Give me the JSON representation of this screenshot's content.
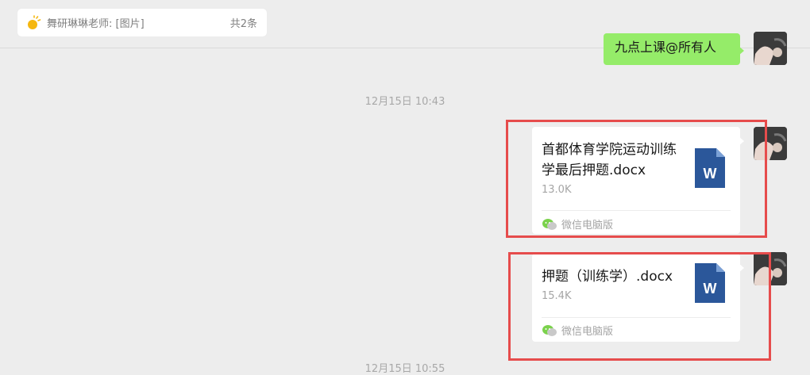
{
  "pinned_bar": {
    "text": "舞研琳琳老师: [图片]",
    "count": "共2条"
  },
  "messages": {
    "prev_text": "九点上课@所有人",
    "timestamp_1": "12月15日 10:43",
    "timestamp_2": "12月15日 10:55",
    "file_1": {
      "name": "首都体育学院运动训练学最后押题.docx",
      "size": "13.0K",
      "source": "微信电脑版"
    },
    "file_2": {
      "name": "押题（训练学）.docx",
      "size": "15.4K",
      "source": "微信电脑版"
    }
  },
  "icons": {
    "pin": "sun-pin-icon",
    "word": "word-document-icon",
    "wechat": "wechat-icon"
  },
  "colors": {
    "accent_green": "#95ec69",
    "highlight_red": "#e64c4c",
    "word_blue": "#2b579a"
  }
}
